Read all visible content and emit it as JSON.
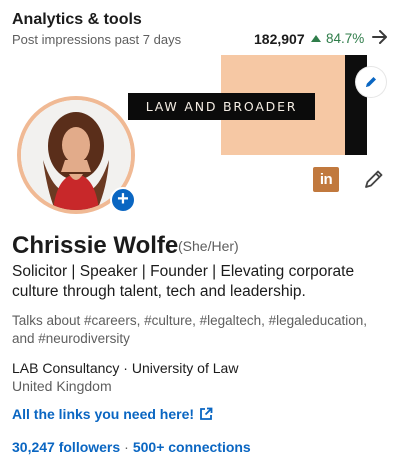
{
  "analytics": {
    "title": "Analytics & tools",
    "subtitle": "Post impressions past 7 days",
    "count": "182,907",
    "trend": "84.7%",
    "trend_color": "#2f7d4a",
    "arrow_icon": "arrow-right-icon"
  },
  "banner": {
    "label": "LAW AND BROADER",
    "peach_color": "#f6c8a4",
    "edit_icon": "pencil-icon"
  },
  "profile": {
    "name": "Chrissie Wolfe",
    "pronouns": "(She/Her)",
    "headline": "Solicitor | Speaker | Founder | Elevating corporate culture through talent, tech and leadership.",
    "talks": "Talks about #careers, #culture, #legaltech, #legaleducation, and #neurodiversity",
    "company": "LAB Consultancy · University of Law",
    "location": "United Kingdom",
    "links_label": "All the links you need here!",
    "followers": "30,247 followers",
    "connections": "500+ connections",
    "badge_text": "in",
    "add_label": "+",
    "separator": "·"
  },
  "colors": {
    "accent": "#0a66c2",
    "avatar_ring": "#f0b994",
    "badge": "#c1793e"
  }
}
